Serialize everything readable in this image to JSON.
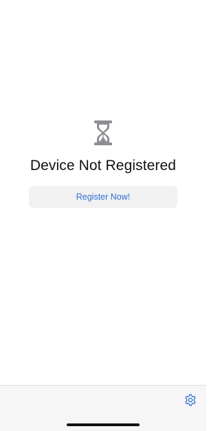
{
  "status": {
    "icon": "hourglass-icon",
    "title": "Device Not Registered"
  },
  "actions": {
    "register_label": "Register Now!"
  },
  "toolbar": {
    "settings_icon": "gear-icon"
  },
  "colors": {
    "accent": "#2f6fcf",
    "icon_gray": "#8e8e93",
    "button_bg": "#f1f1f2",
    "bar_bg": "#f6f6f7"
  }
}
